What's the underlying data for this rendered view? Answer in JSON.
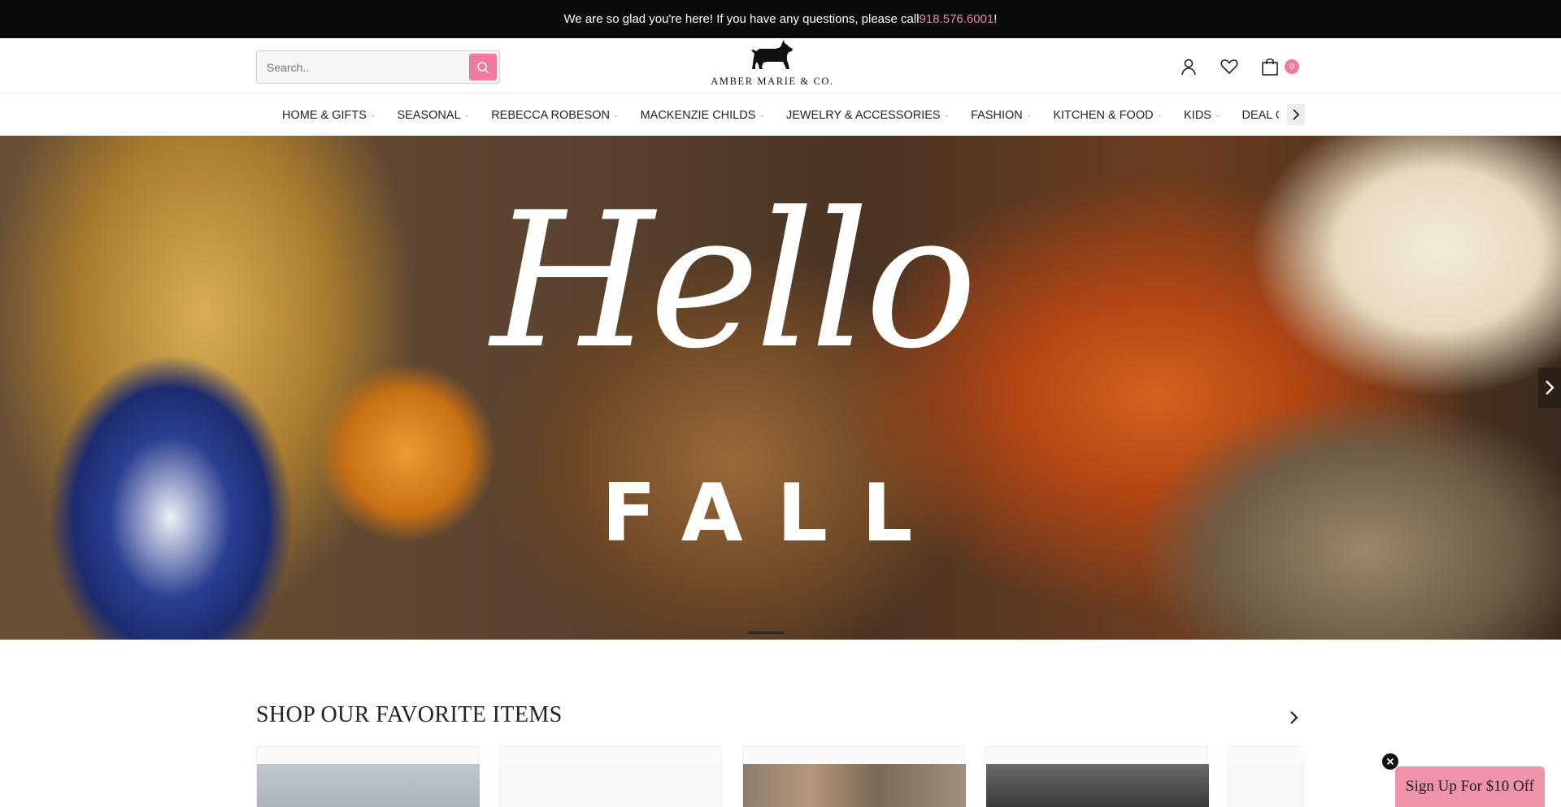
{
  "announcement": {
    "text": "We are so glad you're here! If you have any questions, please call ",
    "phone": "918.576.6001",
    "suffix": "!"
  },
  "header": {
    "search": {
      "placeholder": "Search.."
    },
    "brand": "AMBER MARIE & CO.",
    "icons": [
      "account-icon",
      "heart-icon",
      "bag-icon"
    ],
    "cart_count": "0"
  },
  "nav": {
    "items": [
      {
        "label": "HOME & GIFTS",
        "has_dropdown": true
      },
      {
        "label": "SEASONAL",
        "has_dropdown": true
      },
      {
        "label": "REBECCA ROBESON",
        "has_dropdown": true
      },
      {
        "label": "MACKENZIE CHILDS",
        "has_dropdown": true
      },
      {
        "label": "JEWELRY & ACCESSORIES",
        "has_dropdown": true
      },
      {
        "label": "FASHION",
        "has_dropdown": true
      },
      {
        "label": "KITCHEN & FOOD",
        "has_dropdown": true
      },
      {
        "label": "KIDS",
        "has_dropdown": true
      },
      {
        "label": "DEAL OF THE",
        "has_dropdown": false
      }
    ]
  },
  "hero": {
    "script_text": "Hello",
    "block_text": "FALL"
  },
  "favorites": {
    "title": "SHOP OUR FAVORITE ITEMS"
  },
  "signup": {
    "label": "Sign Up For $10 Off"
  },
  "colors": {
    "accent_pink": "#ef7c9b",
    "signup_pink": "#f093aa",
    "announce_bg": "#0b0b0b",
    "phone_link": "#e48aa6"
  }
}
